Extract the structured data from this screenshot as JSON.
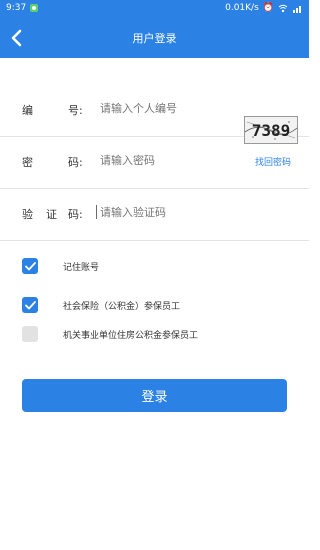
{
  "status": {
    "time": "9:37",
    "net_speed": "0.01K/s",
    "icons": [
      "shield-app-icon",
      "alarm-icon",
      "wifi-icon",
      "signal-icon"
    ]
  },
  "nav": {
    "title": "用户登录",
    "back_icon": "chevron-left-icon"
  },
  "form": {
    "id_label": [
      "编",
      "号:"
    ],
    "id_placeholder": "请输入个人编号",
    "pwd_label": [
      "密",
      "码:"
    ],
    "pwd_placeholder": "请输入密码",
    "forgot_link": "找回密码",
    "code_label": [
      "验",
      "证",
      "码:"
    ],
    "code_placeholder": "请输入验证码",
    "captcha_text": "7389"
  },
  "options": [
    {
      "label": "记住账号",
      "checked": true
    },
    {
      "label": "社会保险（公积金）参保员工",
      "checked": true
    },
    {
      "label": "机关事业单位住房公积金参保员工",
      "checked": false
    }
  ],
  "login_label": "登录",
  "colors": {
    "primary": "#2b82e4",
    "checkbox_off": "#e2e2e2"
  }
}
